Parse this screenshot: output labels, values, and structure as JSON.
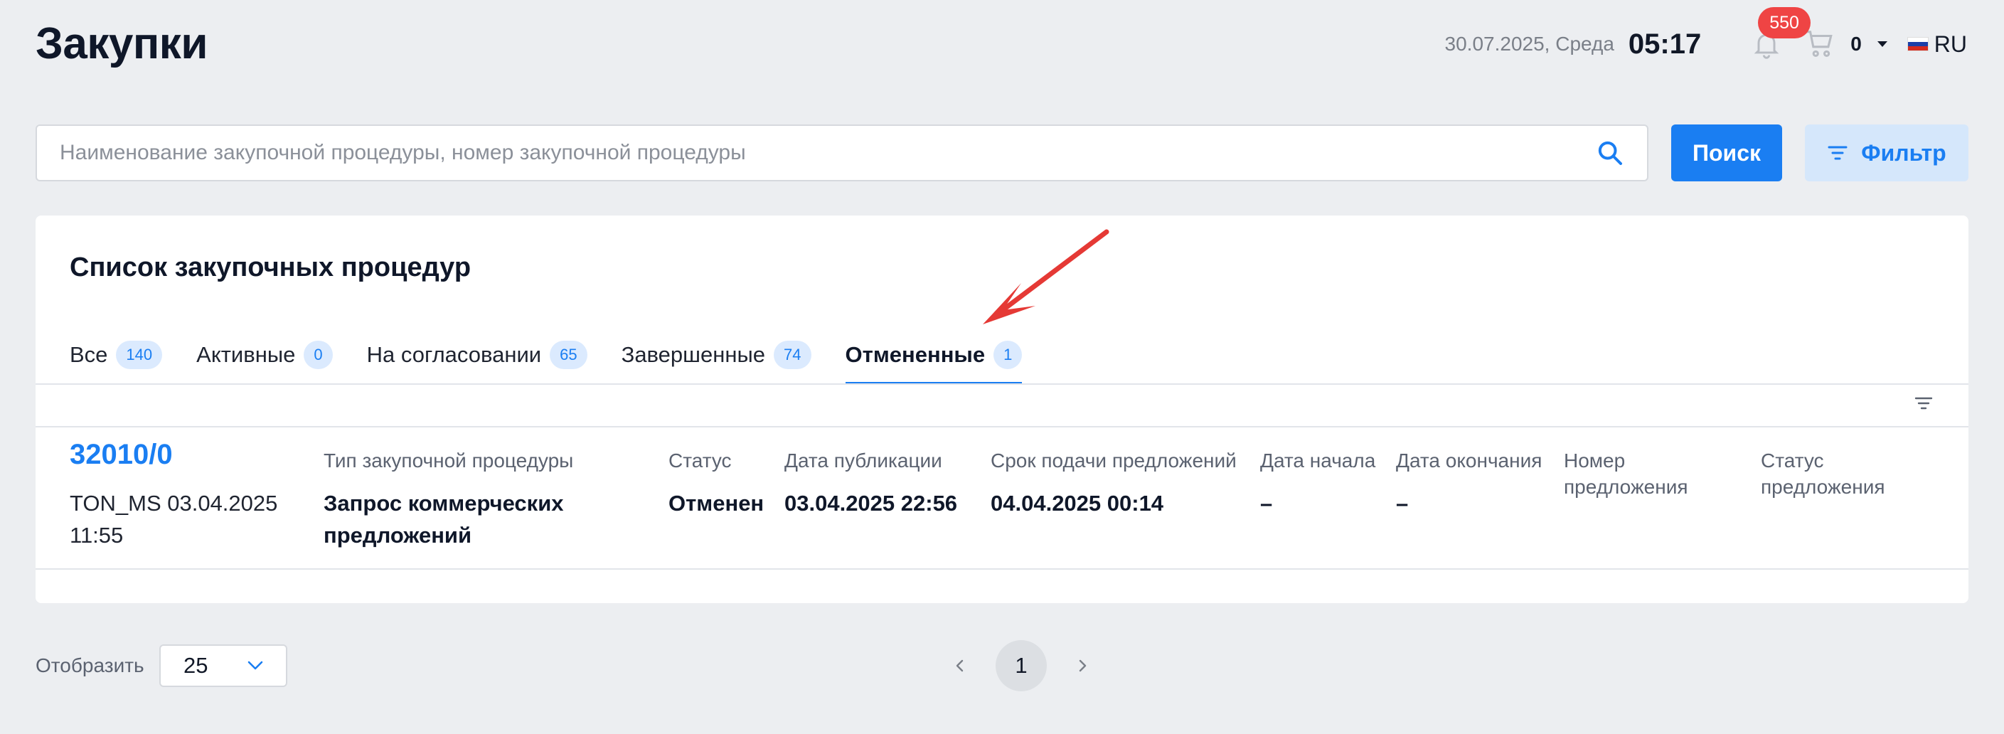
{
  "header": {
    "title": "Закупки",
    "date": "30.07.2025, Среда",
    "time": "05:17",
    "notifications_count": "550",
    "cart_count": "0",
    "language": "RU"
  },
  "search": {
    "placeholder": "Наименование закупочной процедуры, номер закупочной процедуры",
    "search_button": "Поиск",
    "filter_button": "Фильтр"
  },
  "list": {
    "title": "Список закупочных процедур",
    "tabs": [
      {
        "label": "Все",
        "count": "140"
      },
      {
        "label": "Активные",
        "count": "0"
      },
      {
        "label": "На согласовании",
        "count": "65"
      },
      {
        "label": "Завершенные",
        "count": "74"
      },
      {
        "label": "Отмененные",
        "count": "1"
      }
    ],
    "active_tab": "Отмененные",
    "columns": {
      "type": "Тип закупочной процедуры",
      "status": "Статус",
      "published": "Дата публикации",
      "deadline": "Срок подачи предложений",
      "start": "Дата начала",
      "end": "Дата окончания",
      "offer_number": "Номер предложения",
      "offer_status": "Статус предложения"
    },
    "rows": [
      {
        "number": "32010/0",
        "meta": "TON_MS 03.04.2025 11:55",
        "type": "Запрос коммерческих предложений",
        "status": "Отменен",
        "published": "03.04.2025 22:56",
        "deadline": "04.04.2025 00:14",
        "start": "–",
        "end": "–"
      }
    ]
  },
  "footer": {
    "show_label": "Отобразить",
    "page_size": "25",
    "current_page": "1"
  },
  "colors": {
    "accent": "#1a7ef2",
    "badge": "#ef4444",
    "annotation": "#e53935"
  }
}
